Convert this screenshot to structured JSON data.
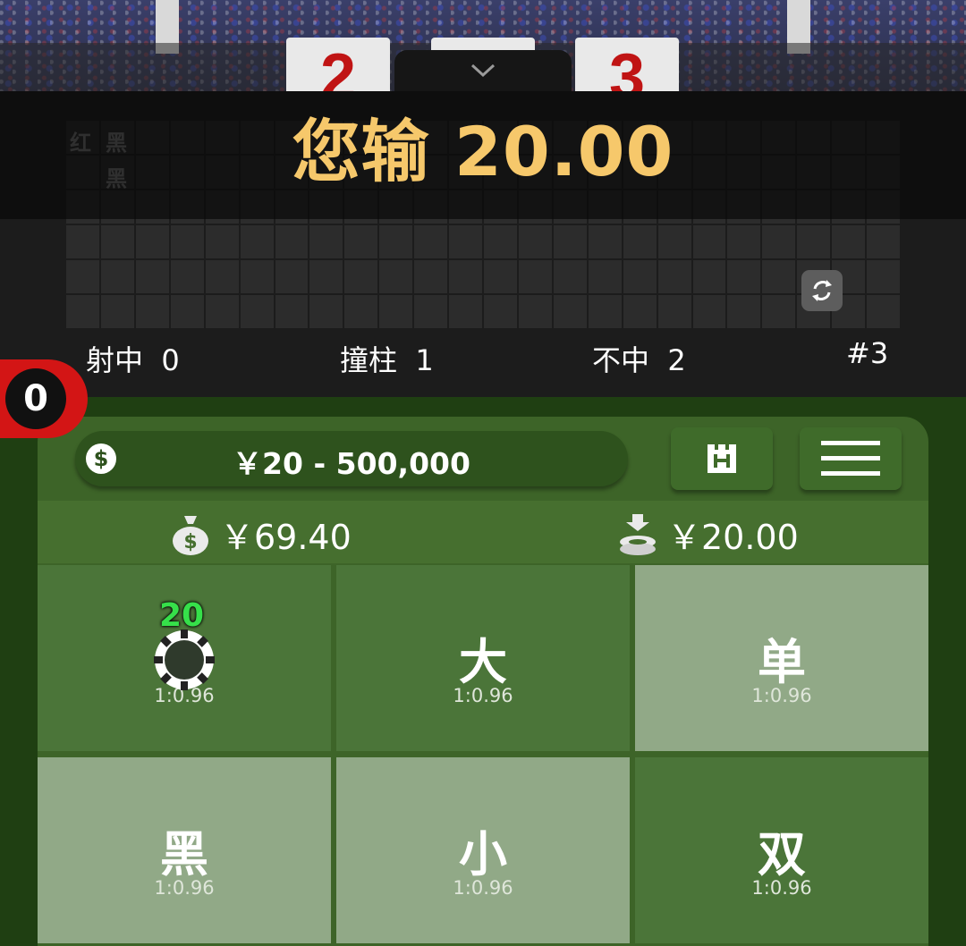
{
  "scoreboard": {
    "left_score": "2",
    "right_score": "3"
  },
  "result": {
    "message": "您输 20.00"
  },
  "road": {
    "marks": [
      "红",
      "黑",
      "黑"
    ]
  },
  "stats": {
    "hit_label": "射中",
    "hit_value": "0",
    "post_label": "撞柱",
    "post_value": "1",
    "miss_label": "不中",
    "miss_value": "2",
    "round": "#3"
  },
  "badge": {
    "count": "0"
  },
  "limits": {
    "range": "￥20 - 500,000",
    "coin_symbol": "$"
  },
  "wallet": {
    "balance": "￥69.40",
    "bet_total": "￥20.00"
  },
  "bets": [
    {
      "label": "",
      "odds": "1:0.96",
      "chip": "20"
    },
    {
      "label": "大",
      "odds": "1:0.96"
    },
    {
      "label": "单",
      "odds": "1:0.96"
    },
    {
      "label": "黑",
      "odds": "1:0.96"
    },
    {
      "label": "小",
      "odds": "1:0.96"
    },
    {
      "label": "双",
      "odds": "1:0.96"
    }
  ],
  "colors": {
    "result": "#f6c86b",
    "badge": "#d31515",
    "table": "#3d6428",
    "chip_text": "#36e04a"
  }
}
